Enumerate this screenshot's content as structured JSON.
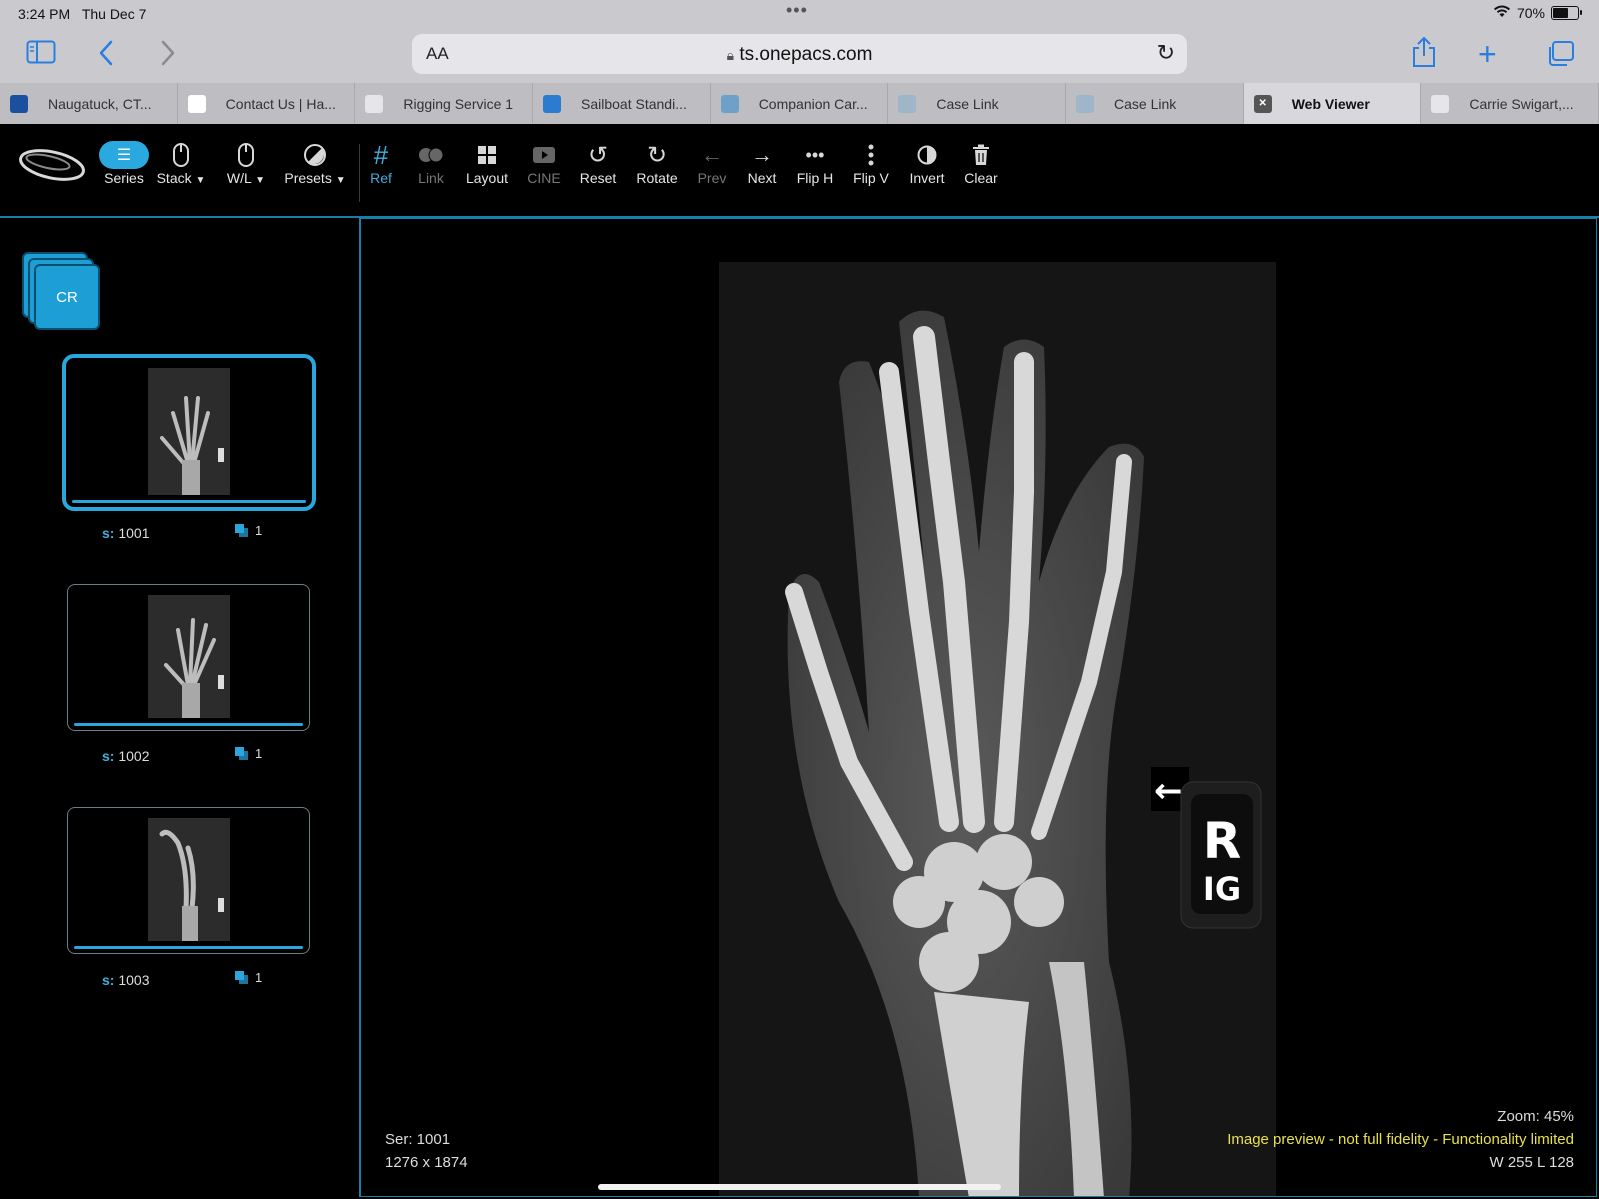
{
  "status": {
    "time": "3:24 PM",
    "date": "Thu Dec 7",
    "battery": "70%",
    "battery_level": 0.7
  },
  "browser": {
    "url": "ts.onepacs.com",
    "text_size_label": "AA"
  },
  "tabs": [
    {
      "label": "Naugatuck, CT...",
      "favicon_color": "#1b4fa0"
    },
    {
      "label": "Contact Us | Ha...",
      "favicon_color": "#ffffff"
    },
    {
      "label": "Rigging Service 1",
      "favicon_color": "#e6e6ea"
    },
    {
      "label": "Sailboat Standi...",
      "favicon_color": "#2b7bd1"
    },
    {
      "label": "Companion Car...",
      "favicon_color": "#6fa0c8"
    },
    {
      "label": "Case Link",
      "favicon_color": "#9fb6c9"
    },
    {
      "label": "Case Link",
      "favicon_color": "#9fb6c9"
    },
    {
      "label": "Web Viewer",
      "favicon_color": "#555555"
    },
    {
      "label": "Carrie Swigart,...",
      "favicon_color": "#e6e6ea"
    }
  ],
  "toolbar": {
    "series": "Series",
    "stack": "Stack",
    "wl": "W/L",
    "presets": "Presets",
    "ref": "Ref",
    "link": "Link",
    "layout": "Layout",
    "cine": "CINE",
    "reset": "Reset",
    "rotate": "Rotate",
    "prev": "Prev",
    "next": "Next",
    "fliph": "Flip H",
    "flipv": "Flip V",
    "invert": "Invert",
    "clear": "Clear"
  },
  "sidebar": {
    "modality": "CR",
    "series": [
      {
        "s_prefix": "s:",
        "number": "1001",
        "count": "1",
        "selected": true
      },
      {
        "s_prefix": "s:",
        "number": "1002",
        "count": "1",
        "selected": false
      },
      {
        "s_prefix": "s:",
        "number": "1003",
        "count": "1",
        "selected": false
      }
    ]
  },
  "viewer": {
    "series_label": "Ser: 1001",
    "dimensions": "1276 x 1874",
    "zoom": "Zoom: 45%",
    "warning": "Image preview - not full fidelity - Functionality limited",
    "window_level": "W 255 L 128",
    "marker_letter": "R",
    "marker_initials": "IG"
  },
  "colors": {
    "accent": "#29a9e0",
    "warning": "#e8e04a",
    "browser_blue": "#2a7de1"
  }
}
